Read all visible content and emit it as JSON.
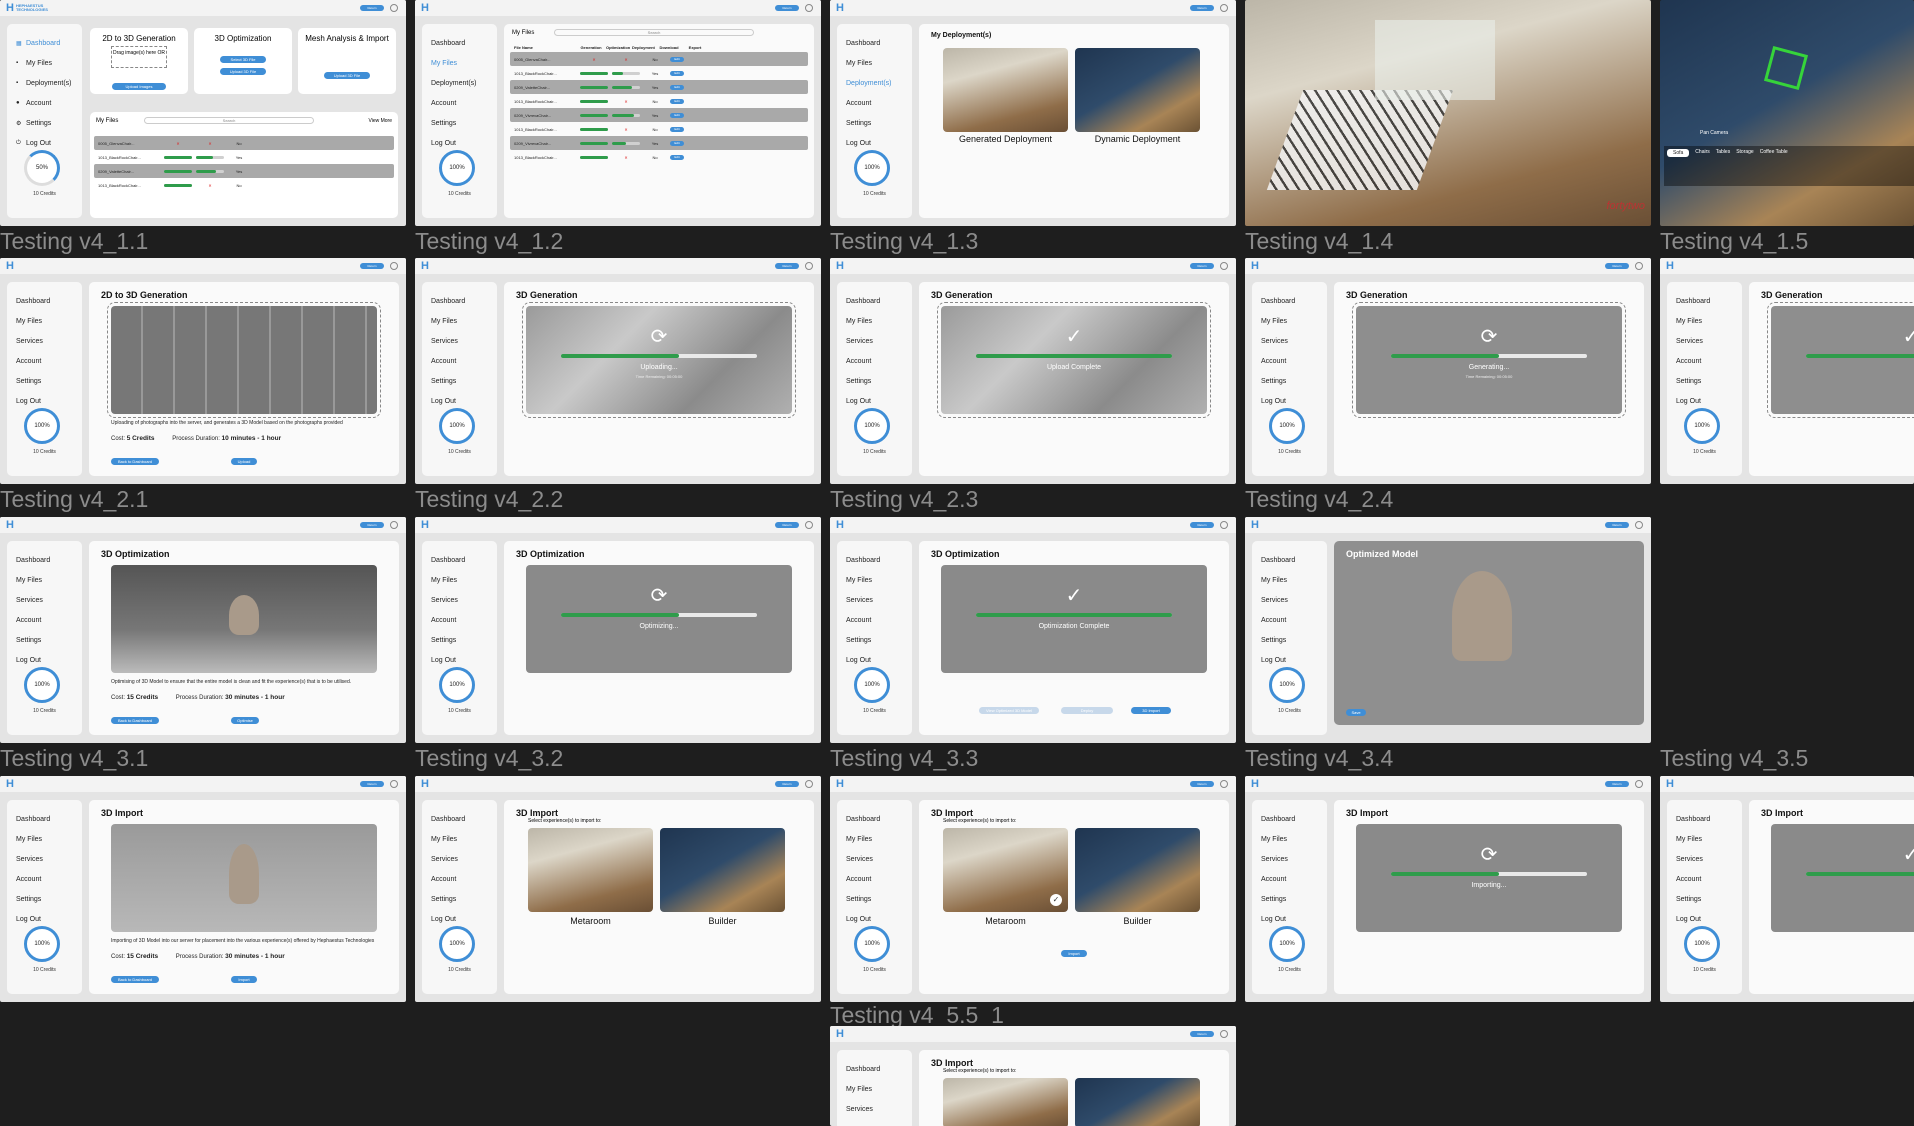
{
  "app": {
    "logo_line1": "HEPHAESTUS",
    "logo_line2": "TECHNOLOGIES",
    "top_button": "Return",
    "accent": "#3f8ed6",
    "progress_color": "#2f9c4b"
  },
  "sidebar_a": [
    "Dashboard",
    "My Files",
    "Deployment(s)",
    "Account",
    "Settings",
    "Log Out"
  ],
  "sidebar_b": [
    "Dashboard",
    "My Files",
    "Services",
    "Account",
    "Settings",
    "Log Out"
  ],
  "credits": {
    "label": "10 Credits",
    "pct50": "50%",
    "pct100": "100%"
  },
  "captions": {
    "c11": "Testing v4_1.1",
    "c12": "Testing v4_1.2",
    "c13": "Testing v4_1.3",
    "c14": "Testing v4_1.4",
    "c15": "Testing v4_1.5",
    "c21": "Testing v4_2.1",
    "c22": "Testing v4_2.2",
    "c23": "Testing v4_2.3",
    "c24": "Testing v4_2.4",
    "c31": "Testing v4_3.1",
    "c32": "Testing v4_3.2",
    "c33": "Testing v4_3.3",
    "c34": "Testing v4_3.4",
    "c35": "Testing v4_3.5",
    "c51": "Testing v4_5.5_1"
  },
  "dashboard": {
    "card1_title": "2D to 3D Generation",
    "card1_drop": "Drag image(s) here OR",
    "card1_btn": "Upload Images",
    "card2_title": "3D Optimization",
    "card2_btn1": "Select 3D File",
    "card2_btn2": "Upload 3D File",
    "card3_title": "Mesh Analysis & Import",
    "card3_btn": "Upload 3D File",
    "files_title": "My Files",
    "search": "Search",
    "view_more": "View More"
  },
  "table": {
    "headers": [
      "File Name",
      "Generation",
      "Optimization",
      "Deployment",
      "Download",
      "Export"
    ],
    "rows": [
      "0005_GlenvaChair...",
      "1013_BlackRockChair...",
      "0209_ValetteChair...",
      "1013_BlackRockChair...",
      "0209_VivrevaChair...",
      "1013_BlackRockChair...",
      "0209_VivrevaChair...",
      "1013_BlackRockChair..."
    ],
    "yes": "Yes",
    "no": "No",
    "edit": "Edit"
  },
  "deploy": {
    "title": "My Deployment(s)",
    "generated": "Generated Deployment",
    "dynamic": "Dynamic Deployment"
  },
  "gen": {
    "title_2d3d": "2D to 3D Generation",
    "title_3dgen": "3D Generation",
    "desc": "Uploading of photographs into the server, and generates a 3D Model based on the photographs provided",
    "cost": "Cost:",
    "cost_val": "5 Credits",
    "duration": "Process Duration:",
    "duration_val": "10 minutes - 1 hour",
    "back": "Back to Dashboard",
    "upload": "Upload",
    "uploading": "Uploading...",
    "upload_complete": "Upload Complete",
    "generating": "Generating...",
    "time_remaining": "Time Remaining: 00:05:00"
  },
  "opt": {
    "title": "3D Optimization",
    "desc": "Optimising of 3D Model to ensure that the entire model is clean and fit the experience(s) that is to be utilised.",
    "cost_val": "15 Credits",
    "duration_val": "30 minutes - 1 hour",
    "optimise": "Optimise",
    "optimizing": "Optimizing...",
    "complete": "Optimization Complete",
    "optimized_model": "Optimized Model",
    "view_model": "View Optimized 3D Model",
    "deploy_btn": "Deploy",
    "import_btn": "3D Import",
    "save": "Save"
  },
  "imp": {
    "title": "3D Import",
    "desc": "Importing of 3D Model into our server for placement into the various experience(s) offered by Hephaestus Technologies",
    "select": "Select experience(s) to import to:",
    "metaroom": "Metaroom",
    "builder": "Builder",
    "import_btn": "Import",
    "importing": "Importing..."
  },
  "viewer": {
    "brand": "fortytwo",
    "pan": "Pan Camera",
    "tabs": [
      "Sofa",
      "Chairs",
      "Tables",
      "Storage",
      "Coffee Table"
    ]
  }
}
